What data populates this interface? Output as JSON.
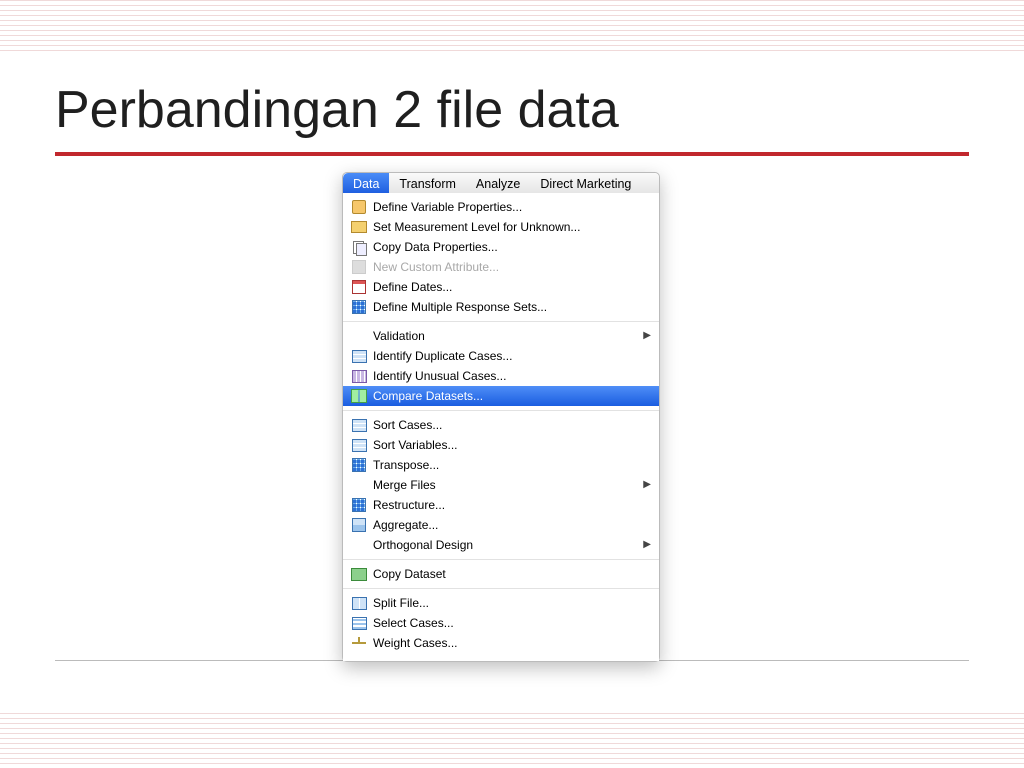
{
  "slide": {
    "title": "Perbandingan 2 file data"
  },
  "menubar": {
    "items": [
      "Data",
      "Transform",
      "Analyze",
      "Direct Marketing"
    ],
    "active_index": 0
  },
  "dropdown": {
    "groups": [
      [
        {
          "label": "Define Variable Properties...",
          "icon": "box-icon"
        },
        {
          "label": "Set Measurement Level for Unknown...",
          "icon": "ruler-icon"
        },
        {
          "label": "Copy Data Properties...",
          "icon": "copy-icon"
        },
        {
          "label": "New Custom Attribute...",
          "icon": "dim-icon",
          "disabled": true
        },
        {
          "label": "Define Dates...",
          "icon": "calendar-icon"
        },
        {
          "label": "Define Multiple Response Sets...",
          "icon": "grid-icon"
        }
      ],
      [
        {
          "label": "Validation",
          "submenu": true,
          "noicon": true
        },
        {
          "label": "Identify Duplicate Cases...",
          "icon": "spread-icon"
        },
        {
          "label": "Identify Unusual Cases...",
          "icon": "bars-icon"
        },
        {
          "label": "Compare Datasets...",
          "icon": "compare-icon",
          "selected": true
        }
      ],
      [
        {
          "label": "Sort Cases...",
          "icon": "spread-icon"
        },
        {
          "label": "Sort Variables...",
          "icon": "spread-icon"
        },
        {
          "label": "Transpose...",
          "icon": "grid-icon"
        },
        {
          "label": "Merge Files",
          "submenu": true,
          "noicon": true
        },
        {
          "label": "Restructure...",
          "icon": "grid-icon"
        },
        {
          "label": "Aggregate...",
          "icon": "agg-icon"
        },
        {
          "label": "Orthogonal Design",
          "submenu": true,
          "noicon": true
        }
      ],
      [
        {
          "label": "Copy Dataset",
          "icon": "copyds-icon"
        }
      ],
      [
        {
          "label": "Split File...",
          "icon": "split-icon"
        },
        {
          "label": "Select Cases...",
          "icon": "select-icon"
        },
        {
          "label": "Weight Cases...",
          "icon": "weight-icon"
        }
      ]
    ]
  }
}
